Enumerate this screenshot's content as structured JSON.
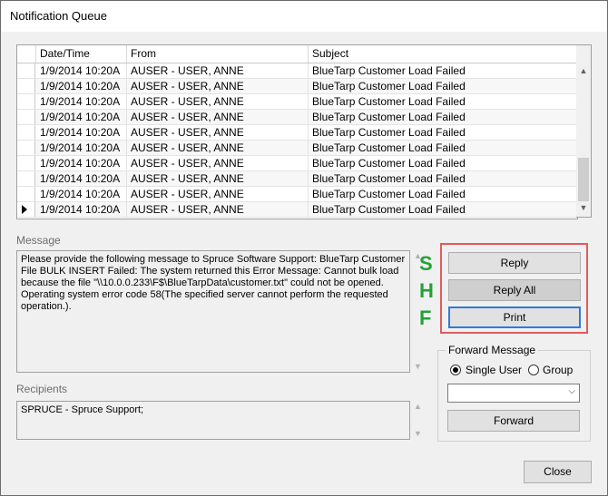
{
  "window": {
    "title": "Notification Queue"
  },
  "grid": {
    "columns": [
      "Date/Time",
      "From",
      "Subject"
    ],
    "rows": [
      [
        "1/9/2014 10:20A",
        "AUSER - USER, ANNE",
        "BlueTarp Customer Load Failed"
      ],
      [
        "1/9/2014 10:20A",
        "AUSER - USER, ANNE",
        "BlueTarp Customer Load Failed"
      ],
      [
        "1/9/2014 10:20A",
        "AUSER - USER, ANNE",
        "BlueTarp Customer Load Failed"
      ],
      [
        "1/9/2014 10:20A",
        "AUSER - USER, ANNE",
        "BlueTarp Customer Load Failed"
      ],
      [
        "1/9/2014 10:20A",
        "AUSER - USER, ANNE",
        "BlueTarp Customer Load Failed"
      ],
      [
        "1/9/2014 10:20A",
        "AUSER - USER, ANNE",
        "BlueTarp Customer Load Failed"
      ],
      [
        "1/9/2014 10:20A",
        "AUSER - USER, ANNE",
        "BlueTarp Customer Load Failed"
      ],
      [
        "1/9/2014 10:20A",
        "AUSER - USER, ANNE",
        "BlueTarp Customer Load Failed"
      ],
      [
        "1/9/2014 10:20A",
        "AUSER - USER, ANNE",
        "BlueTarp Customer Load Failed"
      ],
      [
        "1/9/2014 10:20A",
        "AUSER - USER, ANNE",
        "BlueTarp Customer Load Failed"
      ]
    ],
    "current_row_indicator": "arrow-right-icon"
  },
  "message": {
    "label": "Message",
    "text": "Please provide the following message to Spruce Software Support: BlueTarp Customer File BULK INSERT Failed: The system returned this Error Message: Cannot bulk load because the file \"\\\\10.0.0.233\\F$\\BlueTarpData\\customer.txt\" could not be opened. Operating system error code 58(The specified server cannot perform the requested operation.)."
  },
  "recipients": {
    "label": "Recipients",
    "text": "SPRUCE - Spruce Support;"
  },
  "hotkeys": [
    "S",
    "H",
    "F"
  ],
  "actions": {
    "reply": "Reply",
    "reply_all": "Reply All",
    "print": "Print"
  },
  "forward": {
    "title": "Forward Message",
    "single_user": "Single User",
    "group": "Group",
    "selected_option": "Single User",
    "combo_value": "",
    "button": "Forward"
  },
  "close_button": "Close",
  "colors": {
    "highlight_box": "#e25b5b",
    "hotkey": "#21a336",
    "focus_border": "#2f7bd6"
  }
}
